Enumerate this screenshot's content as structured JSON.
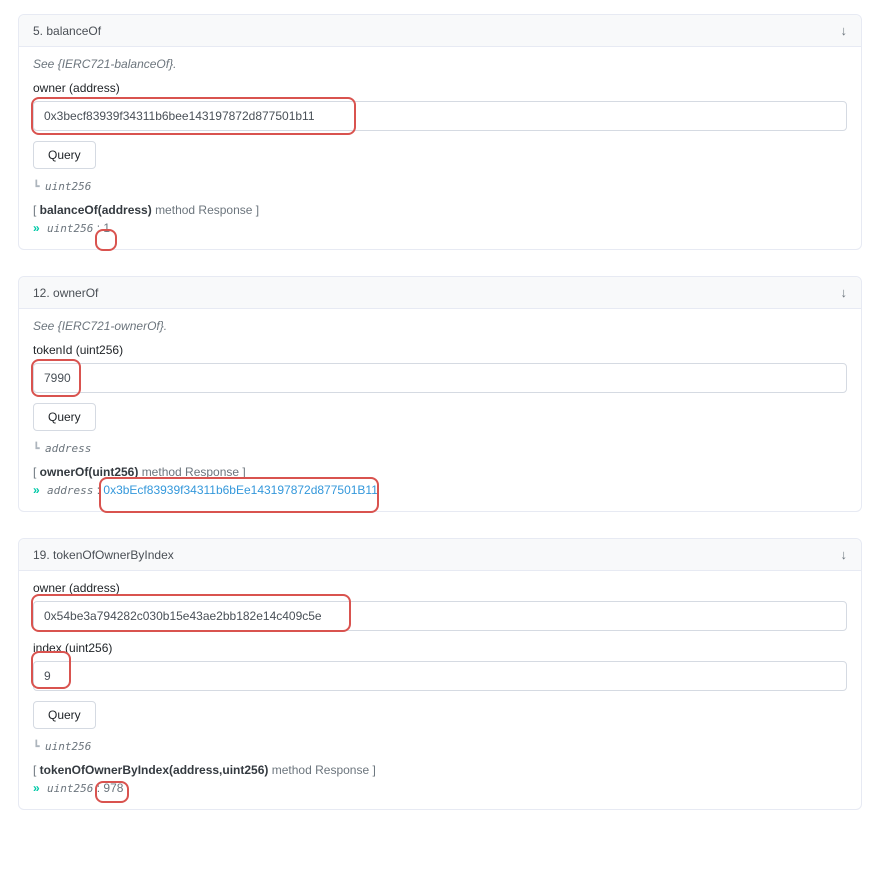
{
  "panels": [
    {
      "index": "5.",
      "name": "balanceOf",
      "see": "See {IERC721-balanceOf}.",
      "fields": [
        {
          "label": "owner (address)",
          "value": "0x3becf83939f34311b6bee143197872d877501b11"
        }
      ],
      "query": "Query",
      "return_type": "uint256",
      "resp_sig": "balanceOf(address)",
      "resp_suffix": "method Response ]",
      "resp_type": "uint256",
      "resp_value": "1",
      "resp_link": false
    },
    {
      "index": "12.",
      "name": "ownerOf",
      "see": "See {IERC721-ownerOf}.",
      "fields": [
        {
          "label": "tokenId (uint256)",
          "value": "7990"
        }
      ],
      "query": "Query",
      "return_type": "address",
      "resp_sig": "ownerOf(uint256)",
      "resp_suffix": "method Response ]",
      "resp_type": "address",
      "resp_value": "0x3bEcf83939f34311b6bEe143197872d877501B11",
      "resp_link": true
    },
    {
      "index": "19.",
      "name": "tokenOfOwnerByIndex",
      "see": "",
      "fields": [
        {
          "label": "owner (address)",
          "value": "0x54be3a794282c030b15e43ae2bb182e14c409c5e"
        },
        {
          "label": "index (uint256)",
          "value": "9"
        }
      ],
      "query": "Query",
      "return_type": "uint256",
      "resp_sig": "tokenOfOwnerByIndex(address,uint256)",
      "resp_suffix": "method Response ]",
      "resp_type": "uint256",
      "resp_value": "978",
      "resp_link": false
    }
  ]
}
